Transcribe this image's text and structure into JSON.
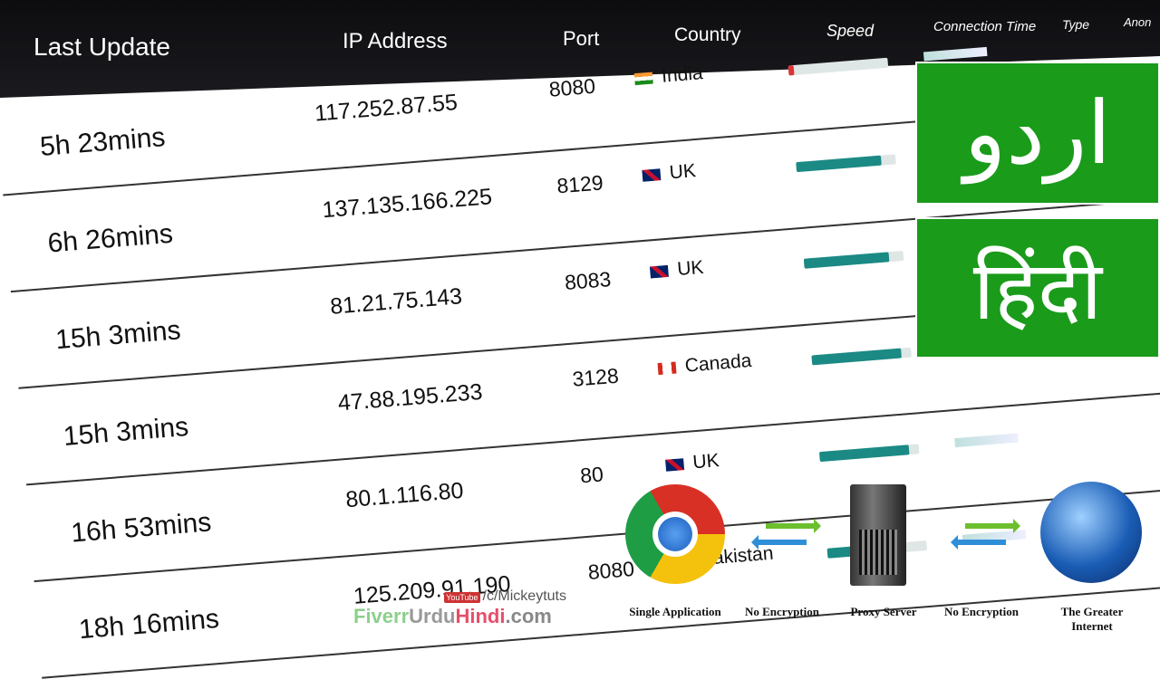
{
  "table": {
    "headers": [
      "Last Update",
      "IP Address",
      "Port",
      "Country",
      "Speed",
      "Connection Time",
      "Type",
      "Anon"
    ],
    "rows": [
      {
        "last_update": "5h 23mins",
        "ip": "117.252.87.55",
        "port": "8080",
        "country": "India",
        "flag": "india-flag",
        "speed": 0.05
      },
      {
        "last_update": "6h 26mins",
        "ip": "137.135.166.225",
        "port": "8129",
        "country": "UK",
        "flag": "uk-flag",
        "speed": 0.85
      },
      {
        "last_update": "15h 3mins",
        "ip": "81.21.75.143",
        "port": "8083",
        "country": "UK",
        "flag": "uk-flag",
        "speed": 0.85
      },
      {
        "last_update": "15h 3mins",
        "ip": "47.88.195.233",
        "port": "3128",
        "country": "Canada",
        "flag": "canada-flag",
        "speed": 0.9
      },
      {
        "last_update": "16h 53mins",
        "ip": "80.1.116.80",
        "port": "80",
        "country": "UK",
        "flag": "uk-flag",
        "speed": 0.9
      },
      {
        "last_update": "18h 16mins",
        "ip": "125.209.91.190",
        "port": "8080",
        "country": "Pakistan",
        "flag": "pakistan-flag",
        "speed": 0.75
      }
    ]
  },
  "badges": {
    "urdu": "اردو",
    "hindi": "हिंदी",
    "color": "#1a9b1a"
  },
  "diagram": {
    "labels": [
      "Single Application",
      "No Encryption",
      "Proxy Server",
      "No Encryption",
      "The Greater Internet"
    ]
  },
  "branding": {
    "youtube": "YouTube",
    "channel": "/c/Mickeytuts",
    "site": [
      "Fiverr",
      "Urdu",
      "Hindi",
      ".com"
    ]
  }
}
